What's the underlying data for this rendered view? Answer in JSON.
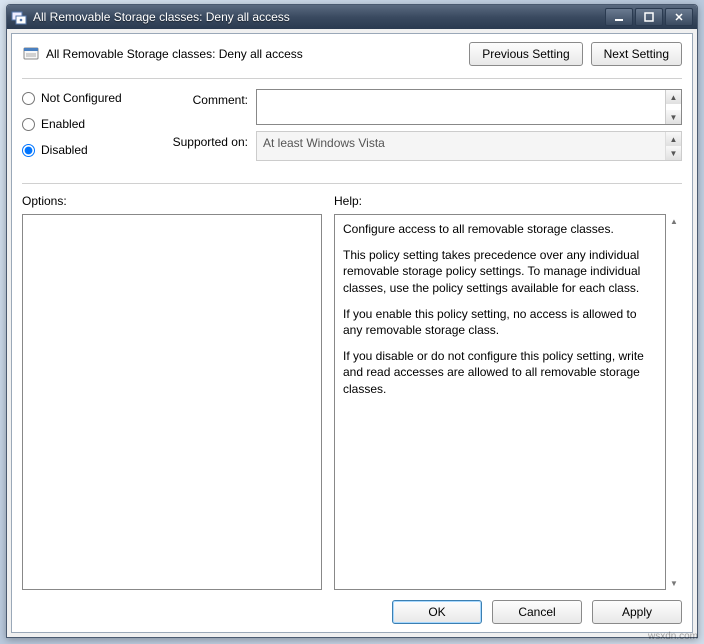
{
  "window": {
    "title": "All Removable Storage classes: Deny all access"
  },
  "header": {
    "policy_title": "All Removable Storage classes: Deny all access",
    "previous_setting": "Previous Setting",
    "next_setting": "Next Setting"
  },
  "config": {
    "radios": {
      "not_configured": "Not Configured",
      "enabled": "Enabled",
      "disabled": "Disabled",
      "selected": "disabled"
    },
    "comment_label": "Comment:",
    "comment_value": "",
    "supported_label": "Supported on:",
    "supported_value": "At least Windows Vista"
  },
  "sections": {
    "options_label": "Options:",
    "help_label": "Help:"
  },
  "help": {
    "p1": "Configure access to all removable storage classes.",
    "p2": "This policy setting takes precedence over any individual removable storage policy settings. To manage individual classes, use the policy settings available for each class.",
    "p3": "If you enable this policy setting, no access is allowed to any removable storage class.",
    "p4": "If you disable or do not configure this policy setting, write and read accesses are allowed to all removable storage classes."
  },
  "buttons": {
    "ok": "OK",
    "cancel": "Cancel",
    "apply": "Apply"
  },
  "watermark": "wsxdn.com"
}
